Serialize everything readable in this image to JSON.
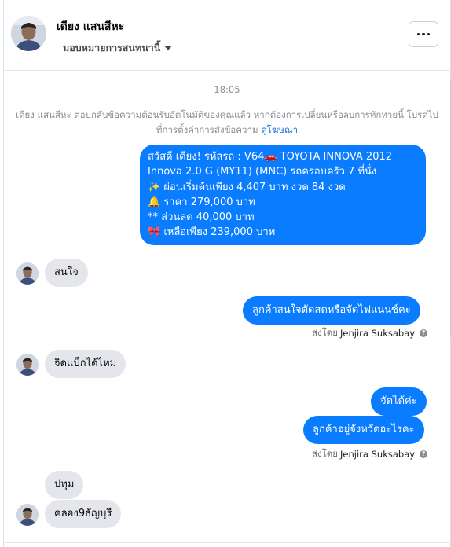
{
  "header": {
    "contact_name": "เดียง แสนสีหะ",
    "assign_label": "มอบหมายการสนทนานี้"
  },
  "thread": {
    "timestamp": "18:05",
    "notice_text": "เดียง แสนสีหะ ตอบกลับข้อความต้อนรับอัตโนมัติของคุณแล้ว หากต้องการเปลี่ยนหรือลบการทักทายนี้ โปรดไปที่การตั้งค่าการส่งข้อความ",
    "notice_link": "ดูโฆษณา",
    "messages": [
      {
        "direction": "out",
        "lines": [
          "สวัสดี เดียง!  รหัสรถ : V64🚗  TOYOTA INNOVA 2012",
          "Innova 2.0 G (MY11) (MNC) รถครอบครัว 7 ที่นั่ง",
          "✨ ผ่อนเริ่มต้นเพียง 4,407 บาท งวด 84 งวด",
          "🔔 ราคา 279,000 บาท",
          "** ส่วนลด 40,000 บาท",
          "🎀 เหลือเพียง 239,000 บาท"
        ]
      },
      {
        "direction": "in",
        "text": "สนใจ"
      },
      {
        "direction": "out",
        "text": "ลูกค้าสนใจตัดสดหรือจัดไฟแนนซ์คะ"
      },
      {
        "direction": "in",
        "text": "จิดแบ็กได้ไหม"
      },
      {
        "direction": "out",
        "text": "จัดได้ค่ะ"
      },
      {
        "direction": "out",
        "text": "ลูกค้าอยู่จังหวัดอะไรคะ"
      },
      {
        "direction": "in",
        "text": "ปทุม"
      },
      {
        "direction": "in",
        "text": "คลอง9ธัญบุรี"
      }
    ],
    "sent_by_prefix": "ส่งโดย",
    "sent_by_name": "Jenjira Suksabay",
    "help_glyph": "?"
  },
  "colors": {
    "outgoing_bubble": "#0a7cff",
    "incoming_bubble": "#e4e6eb",
    "link": "#216fdb"
  },
  "icons": [
    "avatar",
    "caret-down-icon",
    "more-options-icon",
    "help-icon"
  ]
}
